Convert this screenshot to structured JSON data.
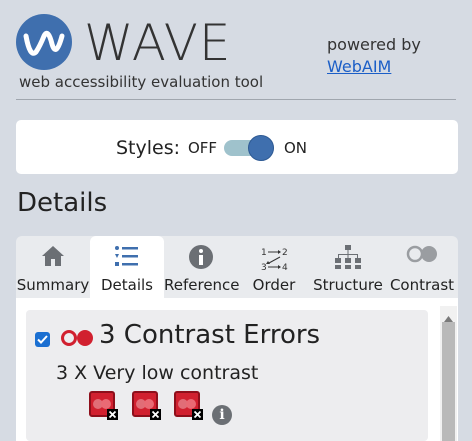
{
  "header": {
    "brand": "WAVE",
    "tagline": "web accessibility evaluation tool",
    "powered_by": "powered by",
    "webaim_link": "WebAIM",
    "logo_icon": "wave-logo-icon"
  },
  "styles_toggle": {
    "label": "Styles:",
    "off_label": "OFF",
    "on_label": "ON",
    "state": "on"
  },
  "section_heading": "Details",
  "tabs": [
    {
      "label": "Summary",
      "icon": "home-icon",
      "active": false
    },
    {
      "label": "Details",
      "icon": "list-icon",
      "active": true
    },
    {
      "label": "Reference",
      "icon": "info-icon",
      "active": false
    },
    {
      "label": "Order",
      "icon": "order-icon",
      "active": false
    },
    {
      "label": "Structure",
      "icon": "structure-icon",
      "active": false
    },
    {
      "label": "Contrast",
      "icon": "contrast-icon",
      "active": false
    }
  ],
  "errors": {
    "checked": true,
    "title": "3 Contrast Errors",
    "item_text": "3 X Very low contrast",
    "count": 3
  },
  "colors": {
    "accent_blue": "#3f6fae",
    "link_blue": "#1b5ec7",
    "error_red": "#d1202f",
    "background": "#d6dbe3"
  }
}
